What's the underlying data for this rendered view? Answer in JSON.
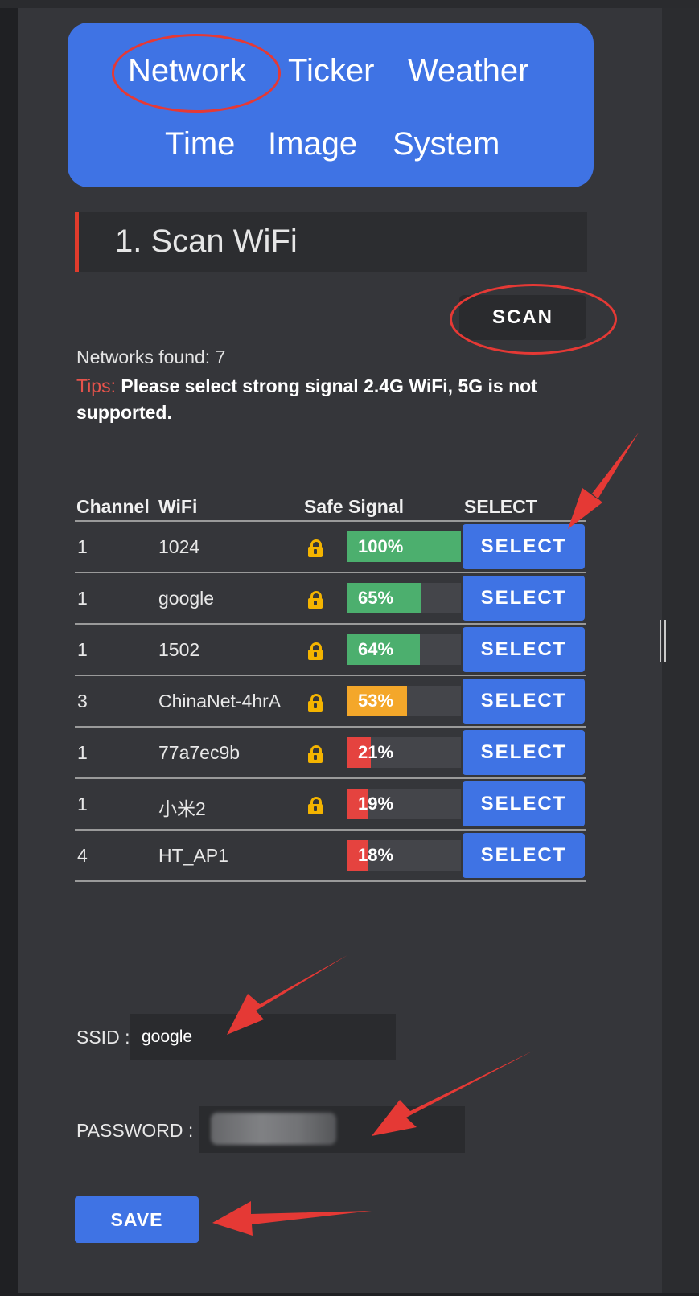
{
  "nav": {
    "items": [
      "Network",
      "Ticker",
      "Weather",
      "Time",
      "Image",
      "System"
    ],
    "active": "Network"
  },
  "section": {
    "title": "1. Scan WiFi"
  },
  "scan_button": "SCAN",
  "networks_found": "Networks found: 7",
  "tips": {
    "label": "Tips:",
    "text": "Please select strong signal 2.4G WiFi, 5G is not supported."
  },
  "table": {
    "headers": [
      "Channel",
      "WiFi",
      "Safe",
      "Signal",
      "SELECT"
    ],
    "rows": [
      {
        "channel": "1",
        "wifi": "1024",
        "safe": true,
        "signal_text": "100%",
        "signal": 100,
        "color": "#4caf6e"
      },
      {
        "channel": "1",
        "wifi": "google",
        "safe": true,
        "signal_text": "65%",
        "signal": 65,
        "color": "#4caf6e"
      },
      {
        "channel": "1",
        "wifi": "1502",
        "safe": true,
        "signal_text": "64%",
        "signal": 64,
        "color": "#4caf6e"
      },
      {
        "channel": "3",
        "wifi": "ChinaNet-4hrA",
        "safe": true,
        "signal_text": "53%",
        "signal": 53,
        "color": "#f4a72a"
      },
      {
        "channel": "1",
        "wifi": "77a7ec9b",
        "safe": true,
        "signal_text": "21%",
        "signal": 21,
        "color": "#e5433f"
      },
      {
        "channel": "1",
        "wifi": "小米2",
        "safe": true,
        "signal_text": "19%",
        "signal": 19,
        "color": "#e5433f"
      },
      {
        "channel": "4",
        "wifi": "HT_AP1",
        "safe": false,
        "signal_text": "18%",
        "signal": 18,
        "color": "#e5433f"
      }
    ],
    "select_label": "SELECT"
  },
  "ssid": {
    "label": "SSID :",
    "value": "google"
  },
  "password": {
    "label": "PASSWORD :"
  },
  "save_button": "SAVE",
  "colors": {
    "accent": "#3f73e4",
    "annotation": "#e53935"
  }
}
